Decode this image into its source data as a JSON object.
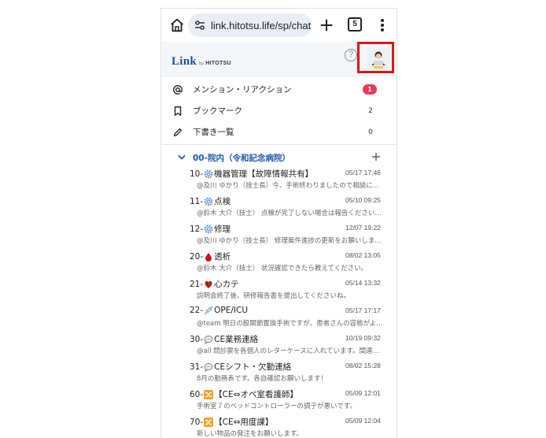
{
  "browser": {
    "url": "link.hitotsu.life/sp/chat",
    "tab_count": "5"
  },
  "header": {
    "logo_main": "Link",
    "logo_by": "by",
    "logo_brand": "HITOTSU",
    "help_symbol": "?",
    "avatar_caption": "HITOTSU"
  },
  "quick": {
    "items": [
      {
        "label": "メンション・リアクション",
        "count": "1",
        "icon": "at-icon"
      },
      {
        "label": "ブックマーク",
        "count": "2",
        "icon": "bookmark-icon"
      },
      {
        "label": "下書き一覧",
        "count": "0",
        "icon": "pencil-icon"
      }
    ]
  },
  "group": {
    "title": "00-院内（令和記念病院）"
  },
  "channels": [
    {
      "prefix": "10-",
      "emoji": "gear-icon",
      "name": "機器管理【故障情報共有】",
      "time": "05/17 17:46",
      "preview": "@及川 ゆかり（技士長）今、手術終わりましたので相談に…"
    },
    {
      "prefix": "11-",
      "emoji": "gear-icon",
      "name": "点検",
      "time": "05/10 09:25",
      "preview": "@鈴木 大介（技士） 点検が完了しない場合は報告ください…"
    },
    {
      "prefix": "12-",
      "emoji": "gear-icon",
      "name": "修理",
      "time": "12/07 19:22",
      "preview": "@及川 ゆかり（技士長） 修理案件進捗の更新をお願いしま…"
    },
    {
      "prefix": "20-",
      "emoji": "blood-drop-icon",
      "name": "透析",
      "time": "08/02 13:05",
      "preview": "@鈴木 大介（技士） 状況確認できたら教えてください。"
    },
    {
      "prefix": "21-",
      "emoji": "heart-icon",
      "name": "心カテ",
      "time": "05/14 13:32",
      "preview": "説明会終了後、研修報告書を提出してくださいね。"
    },
    {
      "prefix": "22-",
      "emoji": "syringe-icon",
      "name": "OPE/ICU",
      "time": "05/17 17:17",
      "preview": "@team 明日の股関節置換手術ですが、患者さんの容態がよ…"
    },
    {
      "prefix": "30-",
      "emoji": "speech-bubble-icon",
      "name": "CE業務連絡",
      "time": "10/19 09:32",
      "preview": "@all 問診票を各個人のレターケースに入れています。間違…"
    },
    {
      "prefix": "31-",
      "emoji": "speech-bubble-icon",
      "name": "CEシフト・欠勤連絡",
      "time": "08/02 15:28",
      "preview": "8月の勤務表です。各自確認お願いします！"
    },
    {
      "prefix": "60-",
      "emoji": "shuffle-icon",
      "name": "【CE⇔オペ室看護師】",
      "time": "05/09 12:01",
      "preview": "手術室７のベッドコントローラーの調子が悪いです。"
    },
    {
      "prefix": "70-",
      "emoji": "shuffle-icon",
      "name": "【CE⇔用度課】",
      "time": "05/09 12:04",
      "preview": "新しい物品の発注をお願いします。"
    }
  ]
}
